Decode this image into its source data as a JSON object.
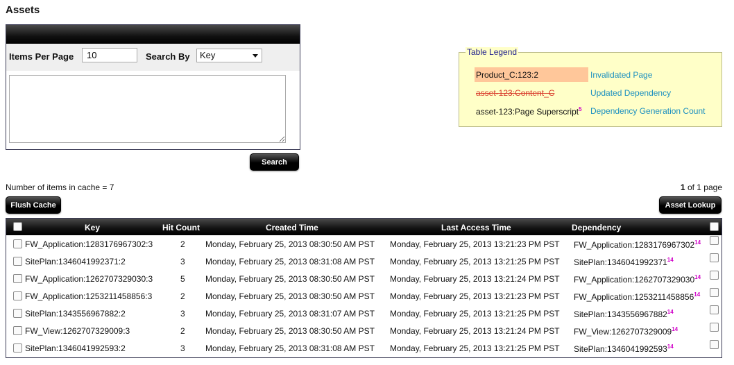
{
  "page": {
    "title": "Assets"
  },
  "search": {
    "items_per_page_label": "Items Per Page",
    "items_per_page_value": "10",
    "search_by_label": "Search By",
    "search_by_selected": "Key",
    "query_value": "",
    "search_button": "Search"
  },
  "legend": {
    "title": "Table Legend",
    "items": [
      {
        "sample": "Product_C:123:2",
        "desc": "Invalidated Page"
      },
      {
        "sample": "asset-123:Content_C",
        "desc": "Updated Dependency"
      },
      {
        "sample": "asset-123:Page Superscript",
        "sup": "5",
        "desc": "Dependency Generation Count"
      }
    ]
  },
  "cache": {
    "count_text": "Number of items in cache = 7",
    "page_current": "1",
    "page_rest": "of 1 page",
    "flush_button": "Flush Cache",
    "lookup_button": "Asset Lookup"
  },
  "table": {
    "headers": {
      "key": "Key",
      "hit_count": "Hit Count",
      "created": "Created Time",
      "last_access": "Last Access Time",
      "dependency": "Dependency"
    },
    "rows": [
      {
        "key": "FW_Application:1283176967302:3",
        "hits": "2",
        "created": "Monday, February 25, 2013 08:30:50 AM PST",
        "last": "Monday, February 25, 2013 13:21:23 PM PST",
        "dep": "FW_Application:1283176967302",
        "sup": "14"
      },
      {
        "key": "SitePlan:1346041992371:2",
        "hits": "3",
        "created": "Monday, February 25, 2013 08:31:08 AM PST",
        "last": "Monday, February 25, 2013 13:21:25 PM PST",
        "dep": "SitePlan:1346041992371",
        "sup": "14"
      },
      {
        "key": "FW_Application:1262707329030:3",
        "hits": "5",
        "created": "Monday, February 25, 2013 08:30:50 AM PST",
        "last": "Monday, February 25, 2013 13:21:24 PM PST",
        "dep": "FW_Application:1262707329030",
        "sup": "14"
      },
      {
        "key": "FW_Application:1253211458856:3",
        "hits": "2",
        "created": "Monday, February 25, 2013 08:30:50 AM PST",
        "last": "Monday, February 25, 2013 13:21:23 PM PST",
        "dep": "FW_Application:1253211458856",
        "sup": "14"
      },
      {
        "key": "SitePlan:1343556967882:2",
        "hits": "3",
        "created": "Monday, February 25, 2013 08:31:07 AM PST",
        "last": "Monday, February 25, 2013 13:21:25 PM PST",
        "dep": "SitePlan:1343556967882",
        "sup": "14"
      },
      {
        "key": "FW_View:1262707329009:3",
        "hits": "2",
        "created": "Monday, February 25, 2013 08:30:50 AM PST",
        "last": "Monday, February 25, 2013 13:21:24 PM PST",
        "dep": "FW_View:1262707329009",
        "sup": "14"
      },
      {
        "key": "SitePlan:1346041992593:2",
        "hits": "3",
        "created": "Monday, February 25, 2013 08:31:08 AM PST",
        "last": "Monday, February 25, 2013 13:21:25 PM PST",
        "dep": "SitePlan:1346041992593",
        "sup": "14"
      }
    ]
  }
}
